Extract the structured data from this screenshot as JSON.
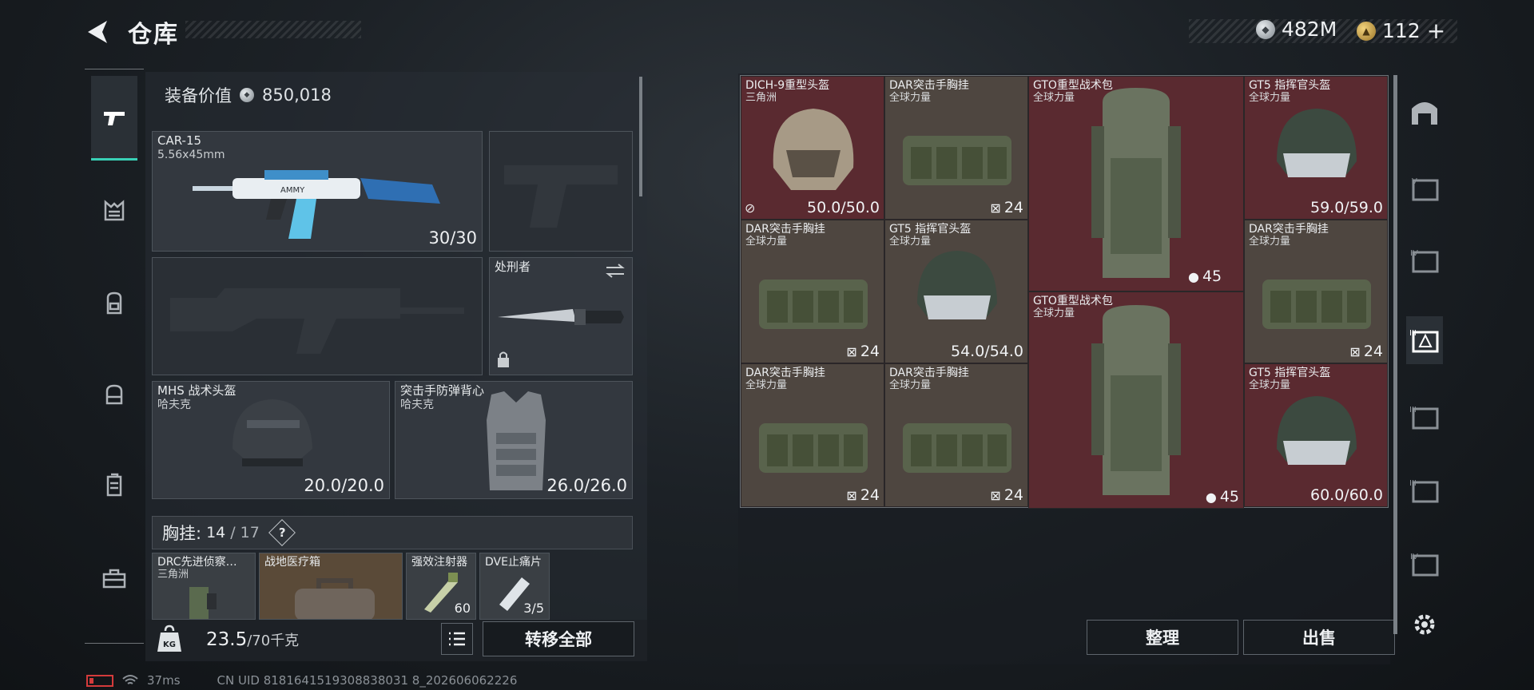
{
  "header": {
    "title": "仓库",
    "currency1": "482M",
    "currency2": "112",
    "plus": "+"
  },
  "loadout": {
    "value_label": "装备价值",
    "value": "850,018",
    "primary": {
      "name": "CAR-15",
      "caliber": "5.56x45mm",
      "ammo": "30/30"
    },
    "melee": {
      "name": "处刑者"
    },
    "helmet": {
      "name": "MHS 战术头盔",
      "brand": "哈夫克",
      "durability": "20.0/20.0"
    },
    "armor": {
      "name": "突击手防弹背心",
      "brand": "哈夫克",
      "durability": "26.0/26.0"
    },
    "chest_rig": {
      "label": "胸挂:",
      "used": "14",
      "sep": "/",
      "total": "17",
      "help": "?"
    },
    "rig_items": [
      {
        "name": "DRC先进侦察…",
        "brand": "三角洲"
      },
      {
        "name": "战地医疗箱"
      },
      {
        "name": "强效注射器",
        "value": "60"
      },
      {
        "name": "DVE止痛片",
        "value": "3/5"
      }
    ]
  },
  "bottom": {
    "weight": "23.5",
    "weight_max": "/70千克",
    "transfer_all": "转移全部",
    "sort": "整理",
    "sell": "出售"
  },
  "status": {
    "ping": "37ms",
    "uid": "CN UID 8181641519308838031 8_202606062226"
  },
  "grid_items": [
    {
      "name": "DICH-9重型头盔",
      "brand": "三角洲",
      "value": "50.0/50.0"
    },
    {
      "name": "DAR突击手胸挂",
      "brand": "全球力量",
      "value": "24"
    },
    {
      "name": "GTO重型战术包",
      "brand": "全球力量"
    },
    {
      "name": "GT5 指挥官头盔",
      "brand": "全球力量",
      "value": "59.0/59.0"
    },
    {
      "name": "DAR突击手胸挂",
      "brand": "全球力量",
      "value": "24"
    },
    {
      "name": "GT5 指挥官头盔",
      "brand": "全球力量",
      "value": "54.0/54.0"
    },
    {
      "name": "DAR突击手胸挂",
      "brand": "全球力量",
      "value": "24"
    },
    {
      "name": "GTO重型战术包",
      "brand": "全球力量",
      "value": "45"
    },
    {
      "name": "DAR突击手胸挂",
      "brand": "全球力量",
      "value": "24"
    },
    {
      "name": "DAR突击手胸挂",
      "brand": "全球力量",
      "value": "24"
    },
    {
      "name": "GT5 指挥官头盔",
      "brand": "全球力量",
      "value": "60.0/60.0"
    },
    {
      "value": "45"
    }
  ],
  "colors": {
    "accent": "#39d0b6",
    "slot_red": "#5a2a30",
    "slot_tan": "#4e4640"
  }
}
